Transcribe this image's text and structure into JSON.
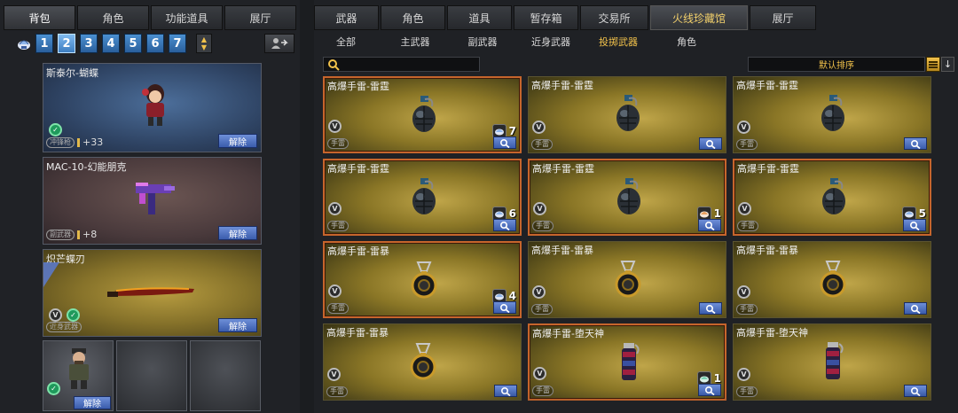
{
  "left": {
    "tabs": [
      "背包",
      "角色",
      "功能道具",
      "展厅"
    ],
    "active_tab": 0,
    "pages": [
      "1",
      "2",
      "3",
      "4",
      "5",
      "6",
      "7"
    ],
    "active_page": 1,
    "cards": [
      {
        "title": "斯泰尔-蝴蝶",
        "tag": "冲锋枪",
        "value": "+33",
        "button": "解除"
      },
      {
        "title": "MAC-10-幻能朋克",
        "tag": "副武器",
        "value": "+8",
        "button": "解除"
      },
      {
        "title": "炽芒蝶刃",
        "tag": "近身武器",
        "value": "",
        "button": "解除"
      }
    ],
    "slot_button": "解除"
  },
  "right": {
    "tabs": [
      "武器",
      "角色",
      "道具",
      "暂存箱",
      "交易所",
      "火线珍藏馆",
      "展厅"
    ],
    "active_tab": 5,
    "subtabs": [
      "全部",
      "主武器",
      "副武器",
      "近身武器",
      "投掷武器",
      "角色"
    ],
    "active_subtab": 4,
    "search": {
      "value": "",
      "placeholder": ""
    },
    "sort_label": "默认排序",
    "items": [
      {
        "name": "高爆手雷-雷霆",
        "type": "手雷",
        "count": "7",
        "art": "grenade-dark",
        "selected": true
      },
      {
        "name": "高爆手雷-雷霆",
        "type": "手雷",
        "count": "",
        "art": "grenade-dark",
        "selected": false
      },
      {
        "name": "高爆手雷-雷霆",
        "type": "手雷",
        "count": "",
        "art": "grenade-dark",
        "selected": false
      },
      {
        "name": "高爆手雷-雷霆",
        "type": "手雷",
        "count": "6",
        "art": "grenade-dark",
        "selected": true
      },
      {
        "name": "高爆手雷-雷霆",
        "type": "手雷",
        "count": "1",
        "art": "grenade-dark",
        "selected": true
      },
      {
        "name": "高爆手雷-雷霆",
        "type": "手雷",
        "count": "5",
        "art": "grenade-dark",
        "selected": true
      },
      {
        "name": "高爆手雷-雷暴",
        "type": "手雷",
        "count": "4",
        "art": "grenade-gold",
        "selected": true
      },
      {
        "name": "高爆手雷-雷暴",
        "type": "手雷",
        "count": "",
        "art": "grenade-gold",
        "selected": false
      },
      {
        "name": "高爆手雷-雷暴",
        "type": "手雷",
        "count": "",
        "art": "grenade-gold",
        "selected": false
      },
      {
        "name": "高爆手雷-雷暴",
        "type": "手雷",
        "count": "",
        "art": "grenade-gold",
        "selected": false
      },
      {
        "name": "高爆手雷-堕天神",
        "type": "手雷",
        "count": "1",
        "art": "grenade-red",
        "selected": true
      },
      {
        "name": "高爆手雷-堕天神",
        "type": "手雷",
        "count": "",
        "art": "grenade-red",
        "selected": false
      }
    ]
  },
  "colors": {
    "accent": "#f2c24b",
    "button_blue": "#4a6fc4",
    "selected_border": "#c6652c"
  }
}
